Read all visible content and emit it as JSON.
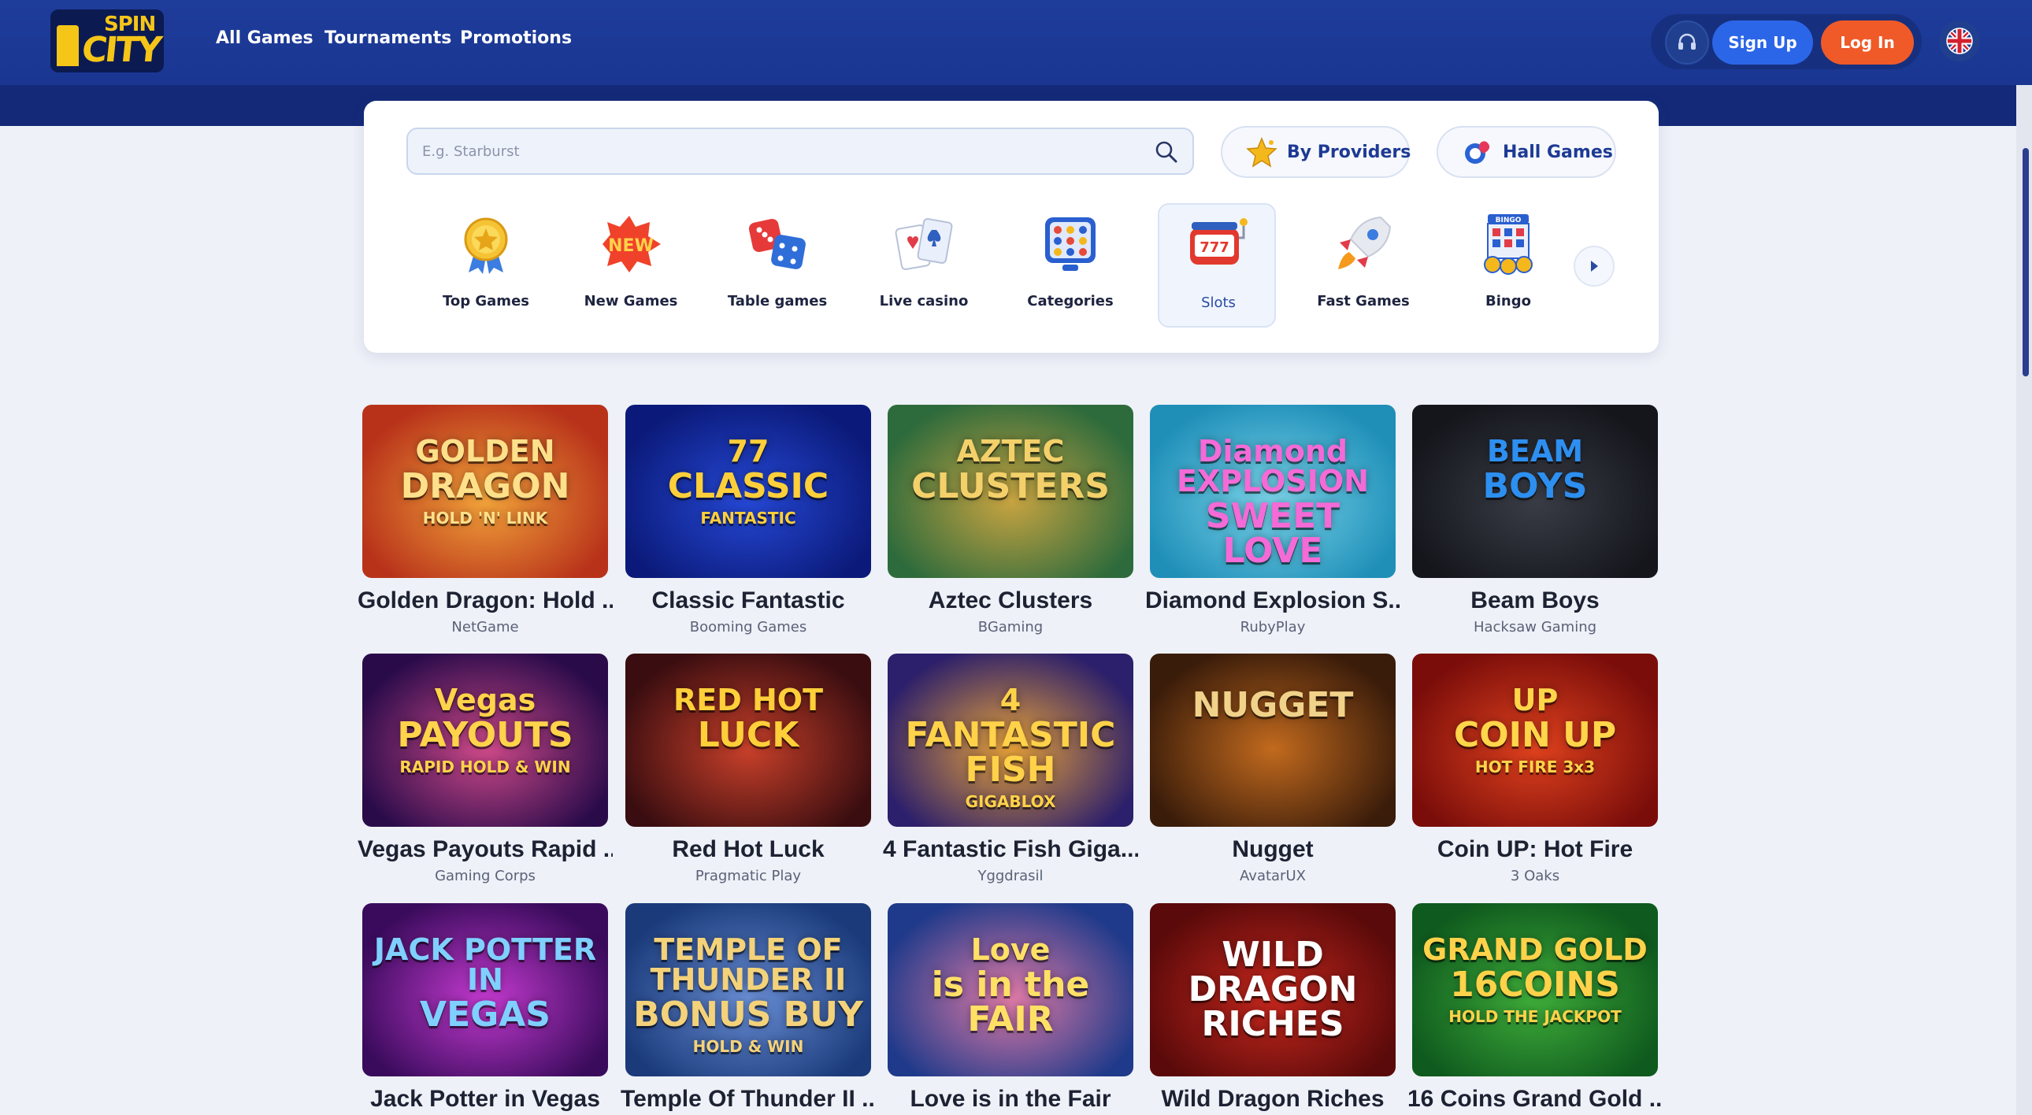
{
  "header": {
    "logo_top": "SPIN",
    "logo_bottom": "CITY",
    "nav": [
      "All Games",
      "Tournaments",
      "Promotions"
    ],
    "signup_label": "Sign Up",
    "login_label": "Log In"
  },
  "search": {
    "placeholder": "E.g. Starburst"
  },
  "filters": {
    "providers_label": "By Providers",
    "hall_label": "Hall Games"
  },
  "categories": [
    {
      "label": "Top Games",
      "icon": "medal-icon"
    },
    {
      "label": "New Games",
      "icon": "new-badge-icon"
    },
    {
      "label": "Table games",
      "icon": "dice-icon"
    },
    {
      "label": "Live casino",
      "icon": "cards-icon"
    },
    {
      "label": "Categories",
      "icon": "grid-icon"
    },
    {
      "label": "Slots",
      "icon": "slot-machine-icon",
      "active": true
    },
    {
      "label": "Fast Games",
      "icon": "rocket-icon"
    },
    {
      "label": "Bingo",
      "icon": "bingo-icon"
    }
  ],
  "games": [
    {
      "title": "Golden Dragon: Hold ...",
      "provider": "NetGame",
      "art": [
        "GOLDEN",
        "DRAGON",
        "HOLD 'N' LINK"
      ],
      "bg": [
        "#b8321a",
        "#f2a33a"
      ],
      "ink": "#ffe08a"
    },
    {
      "title": "Classic Fantastic",
      "provider": "Booming Games",
      "art": [
        "77",
        "CLASSIC",
        "FANTASTIC"
      ],
      "bg": [
        "#0b1a7a",
        "#2649d6"
      ],
      "ink": "#ffcf3a"
    },
    {
      "title": "Aztec Clusters",
      "provider": "BGaming",
      "art": [
        "AZTEC",
        "CLUSTERS",
        ""
      ],
      "bg": [
        "#2e6b3c",
        "#c9a441"
      ],
      "ink": "#f3d06a"
    },
    {
      "title": "Diamond Explosion S...",
      "provider": "RubyPlay",
      "art": [
        "Diamond EXPLOSION",
        "SWEET LOVE",
        ""
      ],
      "bg": [
        "#1f8fb8",
        "#7bd4ea"
      ],
      "ink": "#f46ad7"
    },
    {
      "title": "Beam Boys",
      "provider": "Hacksaw Gaming",
      "art": [
        "BEAM",
        "BOYS",
        ""
      ],
      "bg": [
        "#14161c",
        "#3a3d46"
      ],
      "ink": "#2d8ff0"
    },
    {
      "title": "Vegas Payouts Rapid ...",
      "provider": "Gaming Corps",
      "art": [
        "Vegas",
        "PAYOUTS",
        "RAPID HOLD & WIN"
      ],
      "bg": [
        "#2a0b4a",
        "#d04a8a"
      ],
      "ink": "#ffd34a"
    },
    {
      "title": "Red Hot Luck",
      "provider": "Pragmatic Play",
      "art": [
        "RED HOT",
        "LUCK",
        ""
      ],
      "bg": [
        "#3a0d10",
        "#c8402a"
      ],
      "ink": "#ffcf3a"
    },
    {
      "title": "4 Fantastic Fish Giga...",
      "provider": "Yggdrasil",
      "art": [
        "4",
        "FANTASTIC FISH",
        "GIGABLOX"
      ],
      "bg": [
        "#2c1f6b",
        "#e8a23a"
      ],
      "ink": "#ffd24a"
    },
    {
      "title": "Nugget",
      "provider": "AvatarUX",
      "art": [
        "",
        "NUGGET",
        ""
      ],
      "bg": [
        "#3a1c0a",
        "#c26a1e"
      ],
      "ink": "#f0d28a"
    },
    {
      "title": "Coin UP: Hot Fire",
      "provider": "3 Oaks",
      "art": [
        "UP",
        "COIN UP",
        "HOT FIRE 3x3"
      ],
      "bg": [
        "#7a0d0a",
        "#e0421e"
      ],
      "ink": "#ffd54a"
    },
    {
      "title": "Jack Potter in Vegas",
      "provider": "",
      "art": [
        "JACK POTTER IN",
        "VEGAS",
        ""
      ],
      "bg": [
        "#3a0b5c",
        "#c43ad0"
      ],
      "ink": "#7fd0ff"
    },
    {
      "title": "Temple Of Thunder II ...",
      "provider": "",
      "art": [
        "TEMPLE OF THUNDER II",
        "BONUS BUY",
        "HOLD & WIN"
      ],
      "bg": [
        "#1a3a7a",
        "#6a8fd6"
      ],
      "ink": "#f4d27a"
    },
    {
      "title": "Love is in the Fair",
      "provider": "",
      "art": [
        "Love",
        "is in the FAIR",
        ""
      ],
      "bg": [
        "#1f3a8a",
        "#e07aa6"
      ],
      "ink": "#ffe066"
    },
    {
      "title": "Wild Dragon Riches",
      "provider": "",
      "art": [
        "",
        "WILD DRAGON RICHES",
        ""
      ],
      "bg": [
        "#5a0a0a",
        "#c8281e"
      ],
      "ink": "#ffffff"
    },
    {
      "title": "16 Coins Grand Gold ...",
      "provider": "",
      "art": [
        "GRAND GOLD",
        "16COINS",
        "HOLD THE JACKPOT"
      ],
      "bg": [
        "#0f5a1e",
        "#3fae3a"
      ],
      "ink": "#ffd24a"
    }
  ]
}
